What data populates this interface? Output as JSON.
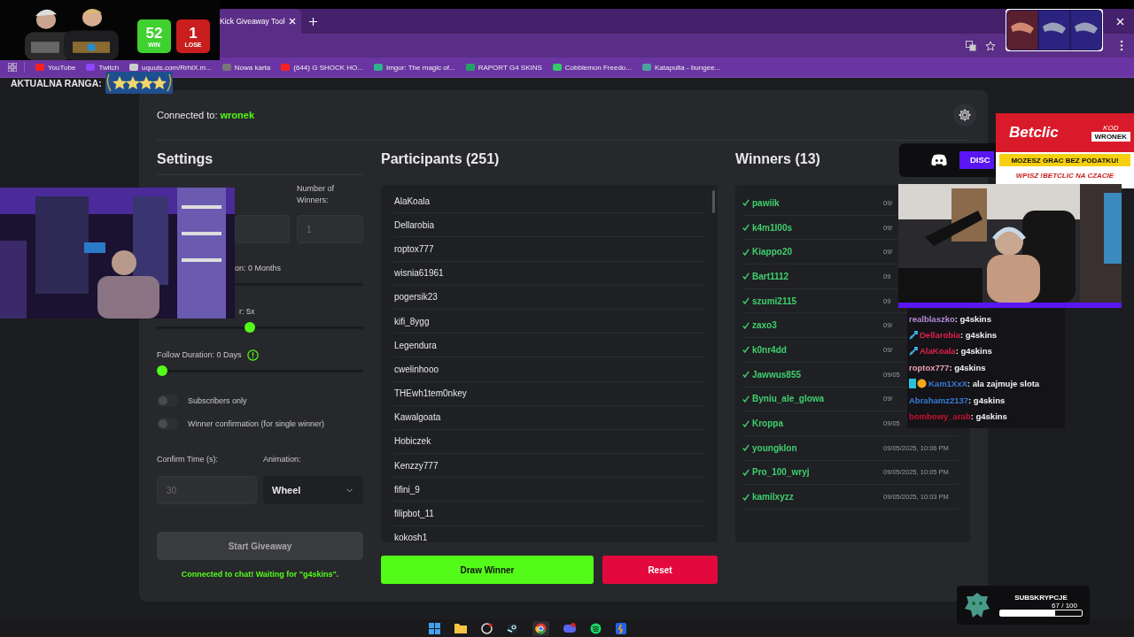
{
  "browser": {
    "tab": {
      "title": "Kick Giveaway Tool"
    },
    "bookmarks": [
      {
        "label": "YouTube",
        "kind": "video"
      },
      {
        "label": "Twitch",
        "kind": "stream"
      },
      {
        "label": "uquuls.com/RrhiX.m...",
        "kind": "link"
      },
      {
        "label": "Nowa karta",
        "kind": "page"
      },
      {
        "label": "(644) G SHOCK HO...",
        "kind": "video"
      },
      {
        "label": "Imgur: The magic of..."
      },
      {
        "label": "RAPORT G4 SKINS",
        "kind": "sheet"
      },
      {
        "label": "Cobblemon Freedo...",
        "kind": "game"
      },
      {
        "label": "Katapulta - bungee...",
        "kind": "site"
      }
    ]
  },
  "app": {
    "connection": {
      "label": "Connected to:",
      "channel": "wronek"
    },
    "settings": {
      "title": "Settings",
      "winners_label": "Number of Winners:",
      "winners_placeholder": "1",
      "sliders": [
        {
          "label": "on: 0 Months"
        },
        {
          "label": "r: 5x",
          "level": 0.45
        },
        {
          "label": "Follow Duration: 0 Days",
          "level": 0,
          "info": true
        }
      ],
      "toggles": [
        {
          "label": "Subscribers only",
          "on": false
        },
        {
          "label": "Winner confirmation (for single winner)",
          "on": false
        }
      ],
      "confirm_label": "Confirm Time (s):",
      "confirm_placeholder": "30",
      "animation_label": "Animation:",
      "animation_value": "Wheel",
      "start_button": {
        "label": "Start Giveaway",
        "disabled": true
      },
      "status": "Connected to chat! Waiting for \"g4skins\"."
    },
    "participants": {
      "title": "Participants (251)",
      "names": [
        "AlaKoala",
        "Dellarobia",
        "roptox777",
        "wisnia61961",
        "pogersik23",
        "kifi_8ygg",
        "Legendura",
        "cwelinhooo",
        "THEwh1tem0nkey",
        "Kawalgoata",
        "Hobiczek",
        "Kenzzy777",
        "fifini_9",
        "filipbot_11",
        "kokosh1"
      ]
    },
    "winners": {
      "title": "Winners (13)",
      "items": [
        {
          "name": "pawiik",
          "date": "09/"
        },
        {
          "name": "k4m1l00s",
          "date": "09/"
        },
        {
          "name": "Kiappo20",
          "date": "09/"
        },
        {
          "name": "Bart1112",
          "date": "09"
        },
        {
          "name": "szumi2115",
          "date": "09"
        },
        {
          "name": "zaxo3",
          "date": "09/"
        },
        {
          "name": "k0nr4dd",
          "date": "09/"
        },
        {
          "name": "Jawwus855",
          "date": "09/05"
        },
        {
          "name": "Byniu_ale_glowa",
          "date": "09/"
        },
        {
          "name": "Kroppa",
          "date": "09/05"
        },
        {
          "name": "youngklon",
          "date": "09/05/2025, 10:06 PM"
        },
        {
          "name": "Pro_100_wryj",
          "date": "09/05/2025, 10:05 PM"
        },
        {
          "name": "kamilxyzz",
          "date": "09/05/2025, 10:03 PM"
        }
      ]
    },
    "draw_button": "Draw Winner",
    "reset_button": "Reset"
  },
  "stream_overlay": {
    "scoreboard": [
      {
        "value": "52",
        "label": "WIN",
        "kind": "win"
      },
      {
        "value": "1",
        "label": "LOSE",
        "kind": "lose"
      }
    ],
    "rank_label": "AKTUALNA RANGA:",
    "sponsor": {
      "brand": "Betclic",
      "code_label": "KOD",
      "code": "WRONEK",
      "tagline": "MOZESZ GRAC BEZ PODATKU!",
      "instruction": "WPISZ !BETCLIC NA CZACIE"
    },
    "discord_label": "DISC",
    "chat": [
      {
        "user": "realblaszko",
        "color": "#b58ad8",
        "message": ": g4skins",
        "kind": "plain"
      },
      {
        "user": "Dellarobia",
        "color": "#e0204a",
        "message": ": g4skins",
        "kind": "sword"
      },
      {
        "user": "AlaKoala",
        "color": "#e0204a",
        "message": ": g4skins",
        "kind": "sword"
      },
      {
        "user": "roptox777",
        "color": "#e8a0b0",
        "message": ": g4skins",
        "kind": "plain"
      },
      {
        "user": "Kam1XxX",
        "color": "#3a7ad8",
        "message": ": ala zajmuje slota",
        "kind": "sub"
      },
      {
        "user": "Abrahamz2137",
        "color": "#3a7ad8",
        "message": ": g4skins",
        "kind": "plain"
      },
      {
        "user": "bombowy_arab",
        "color": "#c8102e",
        "message": ": g4skins",
        "kind": "plain"
      }
    ],
    "sub_goal": {
      "label": "SUBSKRYPCJE",
      "count": "67 / 100",
      "level": 0.67
    }
  }
}
